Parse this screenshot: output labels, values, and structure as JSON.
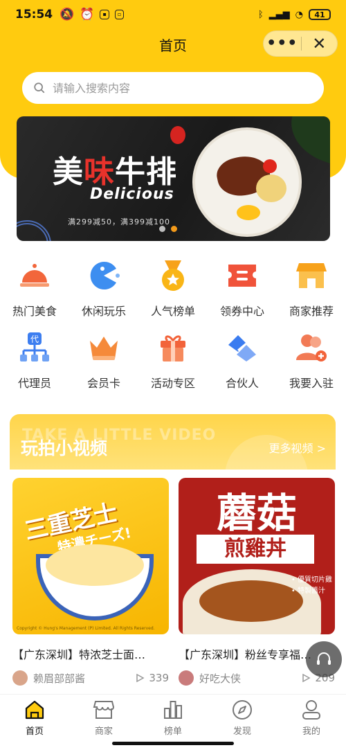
{
  "status_bar": {
    "time": "15:54",
    "battery": "41"
  },
  "title_bar": {
    "title": "首页",
    "more_label": "•••",
    "close_label": "✕"
  },
  "search": {
    "placeholder": "请输入搜索内容"
  },
  "banner": {
    "title_part1": "美",
    "title_part2": "味",
    "title_part3": "牛排",
    "subtitle": "Delicious",
    "promo": "满299减50，满399减100",
    "slide_count": 2,
    "active_slide": 2
  },
  "categories": [
    {
      "label": "热门美食",
      "icon": "cloche-icon",
      "color": "#F2663B"
    },
    {
      "label": "休闲玩乐",
      "icon": "pacman-icon",
      "color": "#3D8EF0"
    },
    {
      "label": "人气榜单",
      "icon": "medal-icon",
      "color": "#F9B516"
    },
    {
      "label": "领券中心",
      "icon": "ticket-icon",
      "color": "#F0533A"
    },
    {
      "label": "商家推荐",
      "icon": "store-icon",
      "color": "#F7A21B"
    },
    {
      "label": "代理员",
      "icon": "org-chart-icon",
      "color": "#3D7EF0"
    },
    {
      "label": "会员卡",
      "icon": "crown-icon",
      "color": "#F58A3A"
    },
    {
      "label": "活动专区",
      "icon": "gift-icon",
      "color": "#F2633A"
    },
    {
      "label": "合伙人",
      "icon": "handshake-icon",
      "color": "#3B7CF0"
    },
    {
      "label": "我要入驻",
      "icon": "add-user-icon",
      "color": "#F27A55"
    }
  ],
  "video_section": {
    "title": "玩拍小视频",
    "bg_text": "TAKE A LITTLE VIDEO",
    "more_label": "更多视频 >"
  },
  "videos": [
    {
      "title": "【广东深圳】特浓芝士面…",
      "author": "赖眉部部酱",
      "plays": "339",
      "img_text1": "三重芝士",
      "img_text2": "特濃チーズ!",
      "img_copy": "Copyright © Hung's Management (P) Limited. All Rights Reserved."
    },
    {
      "title": "【广东深圳】粉丝专享福…",
      "author": "好吃大侠",
      "plays": "209",
      "img_text1": "蘑菇",
      "img_text2": "煎雞丼",
      "img_tag": "• 優質切片雞\n• 特製醬汁"
    }
  ],
  "tabbar": [
    {
      "label": "首页",
      "icon": "home-icon",
      "active": true
    },
    {
      "label": "商家",
      "icon": "shop-icon",
      "active": false
    },
    {
      "label": "榜单",
      "icon": "bar-chart-icon",
      "active": false
    },
    {
      "label": "发现",
      "icon": "compass-icon",
      "active": false
    },
    {
      "label": "我的",
      "icon": "user-icon",
      "active": false
    }
  ],
  "colors": {
    "brand_yellow": "#FFCB0F",
    "accent_orange": "#F39A1A"
  }
}
